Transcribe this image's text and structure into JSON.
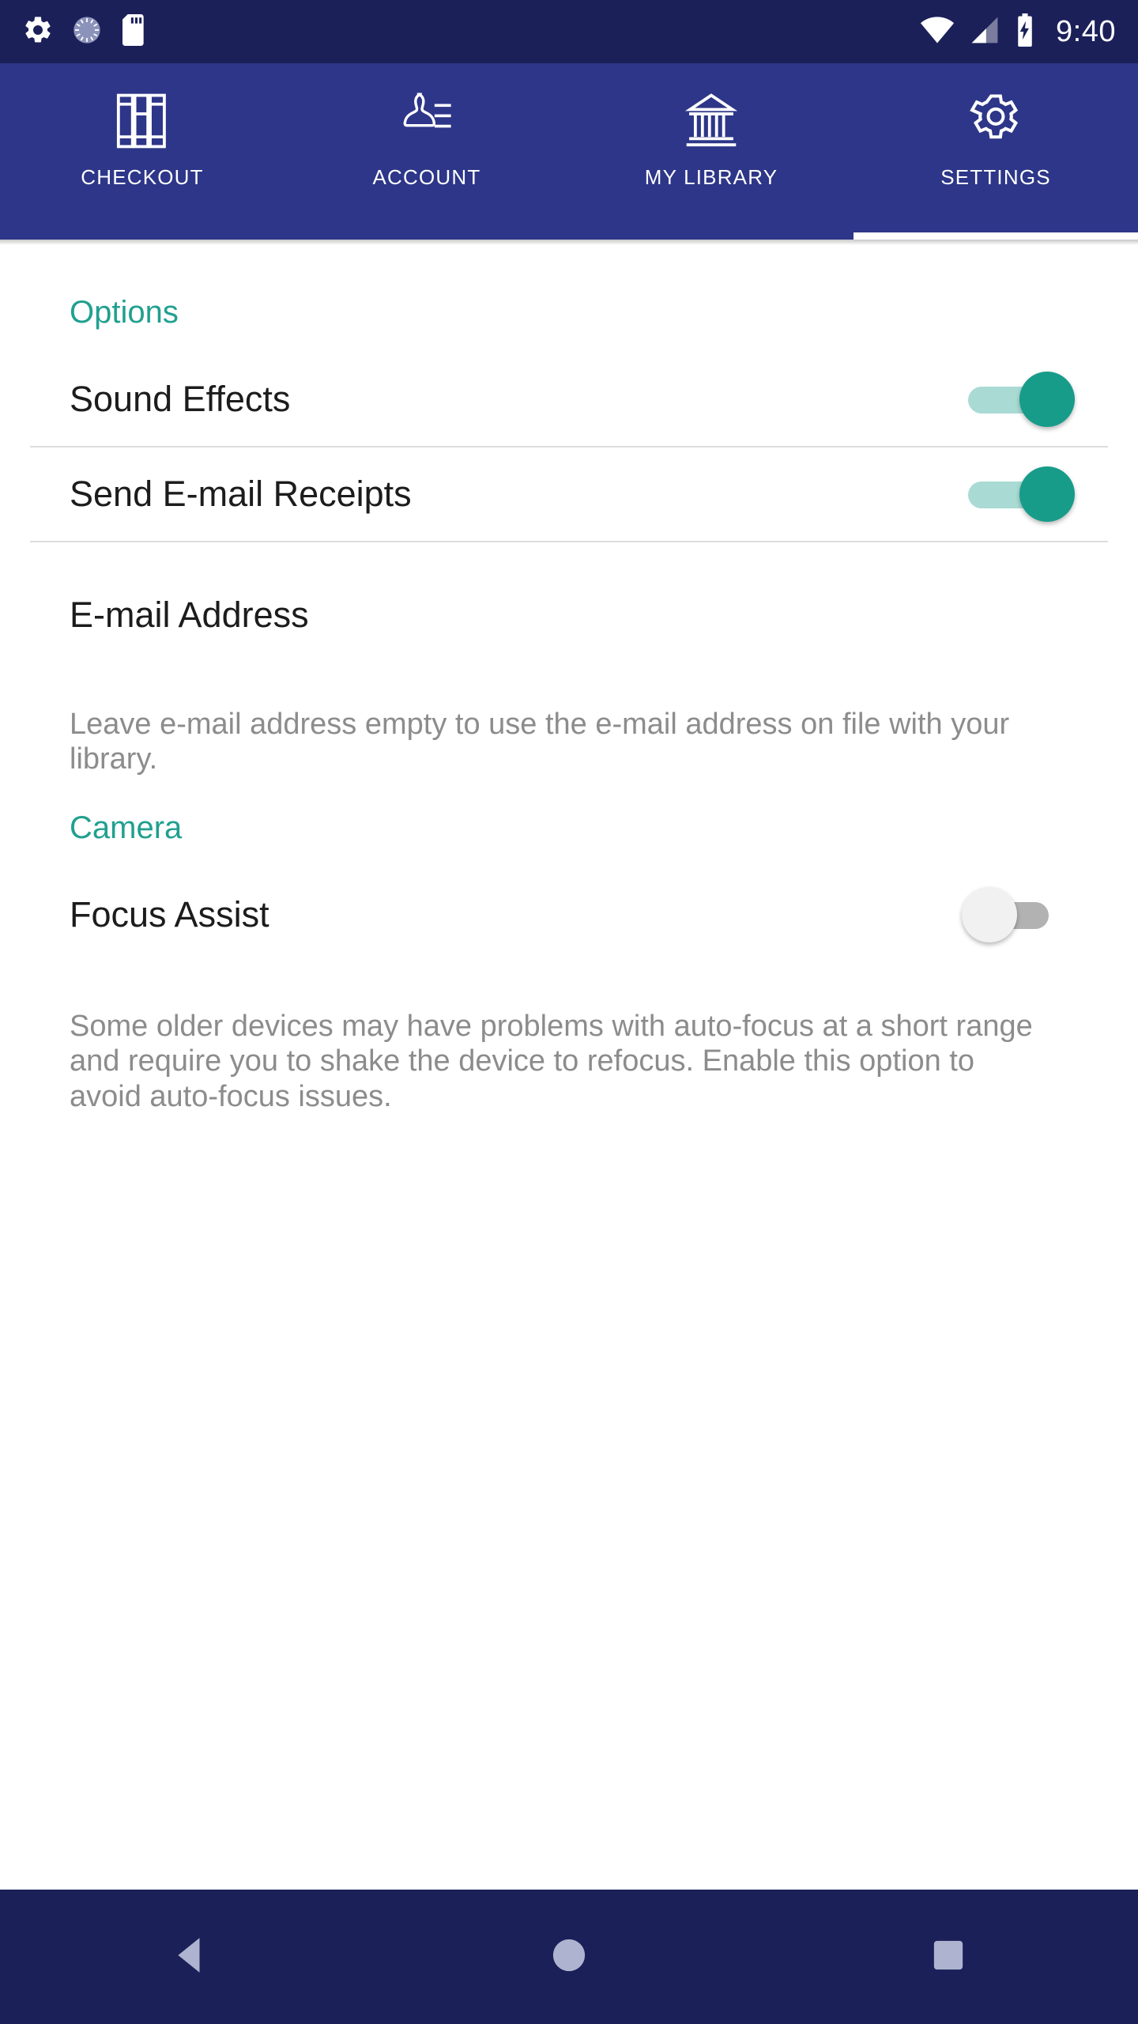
{
  "status_bar": {
    "time": "9:40",
    "left_icons": [
      "settings-gear-icon",
      "sync-progress-icon",
      "sd-card-icon"
    ],
    "right_icons": [
      "wifi-icon",
      "cellular-signal-icon",
      "battery-charging-icon"
    ],
    "background_color": "#1b2059"
  },
  "tabs": {
    "accent_color": "#2d3688",
    "items": [
      {
        "label": "CHECKOUT",
        "icon": "books-icon",
        "active": false
      },
      {
        "label": "ACCOUNT",
        "icon": "person-card-icon",
        "active": false
      },
      {
        "label": "MY LIBRARY",
        "icon": "library-building-icon",
        "active": false
      },
      {
        "label": "SETTINGS",
        "icon": "gear-icon",
        "active": true
      }
    ]
  },
  "sections": {
    "options": {
      "header": "Options",
      "header_color": "#21a08f",
      "sound_effects": {
        "label": "Sound Effects",
        "state": "on"
      },
      "email_receipts": {
        "label": "Send E-mail Receipts",
        "state": "on"
      },
      "email_address": {
        "label": "E-mail Address",
        "value": "",
        "placeholder": "E-mail Address",
        "help": "Leave e-mail address empty to use the e-mail address on file with your library."
      }
    },
    "camera": {
      "header": "Camera",
      "header_color": "#21a08f",
      "focus_assist": {
        "label": "Focus Assist",
        "state": "off",
        "help": "Some older devices may have problems with auto-focus at a short range and require you to shake the device to refocus. Enable this option to avoid auto-focus issues."
      }
    }
  },
  "navigation_bar": {
    "background_color": "#1b2059",
    "buttons": [
      {
        "name": "back-button",
        "icon": "triangle-back-icon"
      },
      {
        "name": "home-button",
        "icon": "circle-home-icon"
      },
      {
        "name": "recents-button",
        "icon": "square-recents-icon"
      }
    ]
  }
}
